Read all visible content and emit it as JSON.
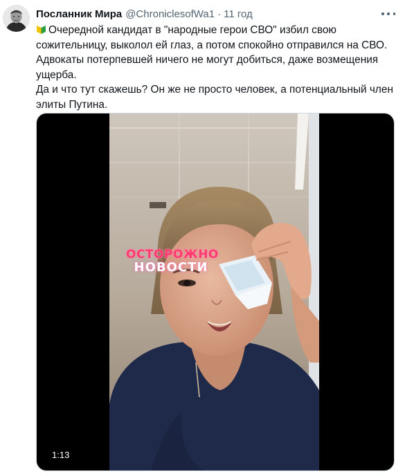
{
  "tweet": {
    "display_name": "Посланник Мира",
    "handle": "@ChroniclesofWa1",
    "separator": "·",
    "time": "11 год",
    "text_lines": [
      "Очередной кандидат в \"народные герои СВО\" избил свою",
      "сожительницу, выколол ей глаз, а потом спокойно отправился на СВО.",
      "Адвокаты потерпевшей ничего не могут добиться, даже возмещения",
      "ущерба.",
      "Да и что тут скажешь? Он же не просто человек, а потенциальный член",
      "элиты Путина."
    ]
  },
  "media": {
    "watermark_top": "ОСТОРОЖНО",
    "watermark_bottom": "НОВОСТИ",
    "duration": "1:13"
  },
  "icons": {
    "avatar": "portrait-avatar",
    "badge": "beginner-badge-icon",
    "more": "more-options-icon"
  },
  "colors": {
    "text": "#0f1419",
    "secondary": "#536471",
    "badge_green": "#2e9e44",
    "badge_yellow": "#f5c400",
    "watermark_pink": "#ff3a6d"
  }
}
